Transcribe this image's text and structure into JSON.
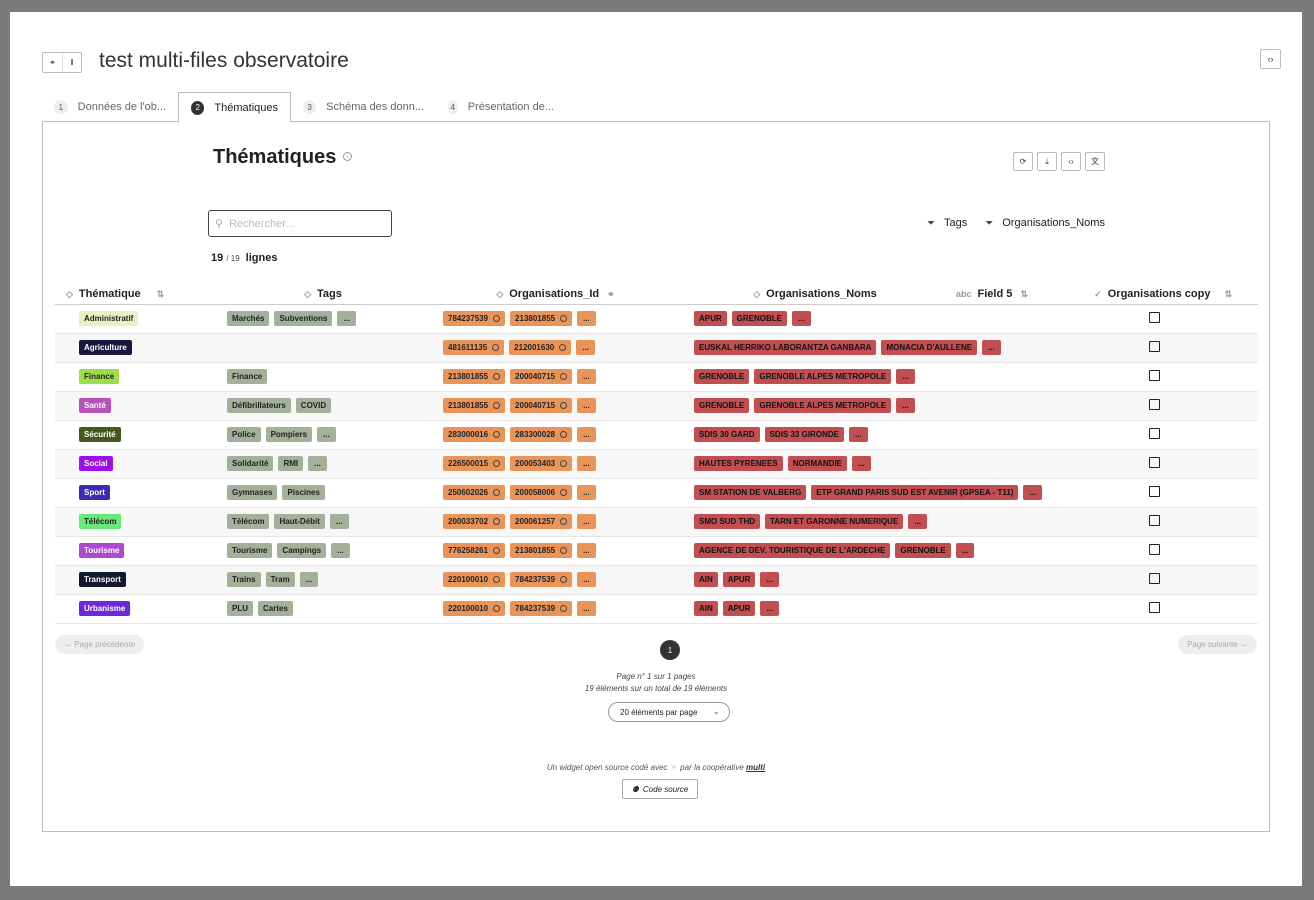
{
  "app": {
    "title": "test multi-files observatoire"
  },
  "tabs": [
    {
      "num": "1",
      "label": "Données de l'ob..."
    },
    {
      "num": "2",
      "label": "Thématiques"
    },
    {
      "num": "3",
      "label": "Schéma des donn..."
    },
    {
      "num": "4",
      "label": "Présentation de..."
    }
  ],
  "widget": {
    "title": "Thématiques"
  },
  "search": {
    "placeholder": "Rechercher..."
  },
  "filters": {
    "f1": "Tags",
    "f2": "Organisations_Noms"
  },
  "count": {
    "shown": "19",
    "total": "19",
    "label": "lignes"
  },
  "columns": {
    "thematique": "Thématique",
    "tags": "Tags",
    "org_id": "Organisations_Id",
    "org_noms": "Organisations_Noms",
    "field5": "Field 5",
    "org_copy": "Organisations copy"
  },
  "more_label": "...",
  "rows": [
    {
      "them": "Administratif",
      "color": "#e8f0c4",
      "light": true,
      "tags": [
        "Marchés",
        "Subventions"
      ],
      "tags_more": true,
      "ids": [
        "784237539",
        "213801855"
      ],
      "noms": [
        "APUR",
        "GRENOBLE"
      ]
    },
    {
      "them": "Agriculture",
      "color": "#171941",
      "light": false,
      "tags": [],
      "tags_more": false,
      "ids": [
        "481611135",
        "212001630"
      ],
      "noms": [
        "EUSKAL HERRIKO LABORANTZA GANBARA",
        "MONACIA D'AULLENE"
      ]
    },
    {
      "them": "Finance",
      "color": "#9ddd4a",
      "light": true,
      "tags": [
        "Finance"
      ],
      "tags_more": false,
      "ids": [
        "213801855",
        "200040715"
      ],
      "noms": [
        "GRENOBLE",
        "GRENOBLE ALPES METROPOLE"
      ]
    },
    {
      "them": "Santé",
      "color": "#b553b9",
      "light": false,
      "tags": [
        "Défibrillateurs",
        "COVID"
      ],
      "tags_more": false,
      "ids": [
        "213801855",
        "200040715"
      ],
      "noms": [
        "GRENOBLE",
        "GRENOBLE ALPES METROPOLE"
      ]
    },
    {
      "them": "Sécurité",
      "color": "#45591e",
      "light": false,
      "tags": [
        "Police",
        "Pompiers"
      ],
      "tags_more": true,
      "ids": [
        "283000016",
        "283300028"
      ],
      "noms": [
        "SDIS 30 GARD",
        "SDIS 33 GIRONDE"
      ]
    },
    {
      "them": "Social",
      "color": "#9b10e6",
      "light": false,
      "tags": [
        "Solidarité",
        "RMI"
      ],
      "tags_more": true,
      "ids": [
        "226500015",
        "200053403"
      ],
      "noms": [
        "HAUTES PYRENEES",
        "NORMANDIE"
      ]
    },
    {
      "them": "Sport",
      "color": "#3b2cb3",
      "light": false,
      "tags": [
        "Gymnases",
        "Piscines"
      ],
      "tags_more": false,
      "ids": [
        "250602026",
        "200058006"
      ],
      "noms": [
        "SM STATION DE VALBERG",
        "ETP GRAND PARIS SUD EST AVENIR (GPSEA - T11)"
      ]
    },
    {
      "them": "Télécom",
      "color": "#66e87a",
      "light": true,
      "tags": [
        "Télécom",
        "Haut-Débit"
      ],
      "tags_more": true,
      "ids": [
        "200033702",
        "200061257"
      ],
      "noms": [
        "SMO SUD THD",
        "TARN ET GARONNE NUMERIQUE"
      ]
    },
    {
      "them": "Tourisme",
      "color": "#ac4ad2",
      "light": false,
      "tags": [
        "Tourisme",
        "Campings"
      ],
      "tags_more": true,
      "ids": [
        "776258261",
        "213801855"
      ],
      "noms": [
        "AGENCE DE DEV. TOURISTIQUE DE L'ARDECHE",
        "GRENOBLE"
      ]
    },
    {
      "them": "Transport",
      "color": "#111a2e",
      "light": false,
      "tags": [
        "Trains",
        "Tram"
      ],
      "tags_more": true,
      "ids": [
        "220100010",
        "784237539"
      ],
      "noms": [
        "AIN",
        "APUR"
      ]
    },
    {
      "them": "Urbanisme",
      "color": "#6d28d9",
      "light": false,
      "tags": [
        "PLU",
        "Cartes"
      ],
      "tags_more": false,
      "ids": [
        "220100010",
        "784237539"
      ],
      "noms": [
        "AIN",
        "APUR"
      ]
    }
  ],
  "pagination": {
    "prev": "← Page précédente",
    "next": "Page suivante →",
    "current": "1",
    "info1": "Page n° 1 sur 1 pages",
    "info2": "19 éléments sur un total de 19 éléments",
    "per_page": "20 éléments par page"
  },
  "footer": {
    "credit_pre": "Un widget open source codé avec",
    "credit_mid": "par la coopérative",
    "credit_link": "multi",
    "source_btn": "Code source"
  },
  "icons": {
    "toggle": [
      "link-icon",
      "pause-icon"
    ],
    "tools": [
      "refresh-icon",
      "download-icon",
      "code-icon",
      "translate-icon"
    ]
  }
}
